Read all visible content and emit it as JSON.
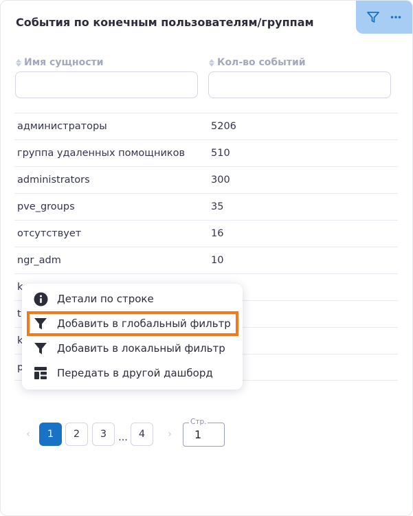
{
  "widget": {
    "title": "События по конечным пользователям/группам"
  },
  "toolbar": {
    "filter_icon": "filter-icon",
    "more_icon": "more-icon",
    "more_label": "···"
  },
  "columns": [
    {
      "label": "Имя сущности",
      "input_value": "",
      "input_placeholder": ""
    },
    {
      "label": "Кол-во событий",
      "input_value": "",
      "input_placeholder": ""
    }
  ],
  "rows": [
    {
      "name": "администраторы",
      "count": "5206"
    },
    {
      "name": "группа удаленных помощников",
      "count": "510"
    },
    {
      "name": "administrators",
      "count": "300"
    },
    {
      "name": "pve_groups",
      "count": "35"
    },
    {
      "name": "отсутствует",
      "count": "16"
    },
    {
      "name": "ngr_adm",
      "count": "10"
    },
    {
      "name": "k",
      "count": ""
    },
    {
      "name": "t",
      "count": ""
    },
    {
      "name": "k",
      "count": ""
    },
    {
      "name": "p",
      "count": ""
    }
  ],
  "context_menu": {
    "items": [
      {
        "label": "Детали по строке",
        "icon": "info-icon"
      },
      {
        "label": "Добавить в глобальный фильтр",
        "icon": "funnel-icon"
      },
      {
        "label": "Добавить в локальный фильтр",
        "icon": "funnel-icon"
      },
      {
        "label": "Передать в другой дашборд",
        "icon": "dashboard-icon"
      }
    ],
    "highlighted_index": 1
  },
  "pagination": {
    "prev": "‹",
    "pages": [
      "1",
      "2",
      "3",
      "4"
    ],
    "ellipsis": "...",
    "next": "›",
    "current": "1",
    "page_field_label": "Стр.",
    "page_field_value": "1"
  },
  "colors": {
    "accent": "#1a72c6",
    "toolbar_bg": "#a7cdf5",
    "highlight": "#f07a1c"
  }
}
